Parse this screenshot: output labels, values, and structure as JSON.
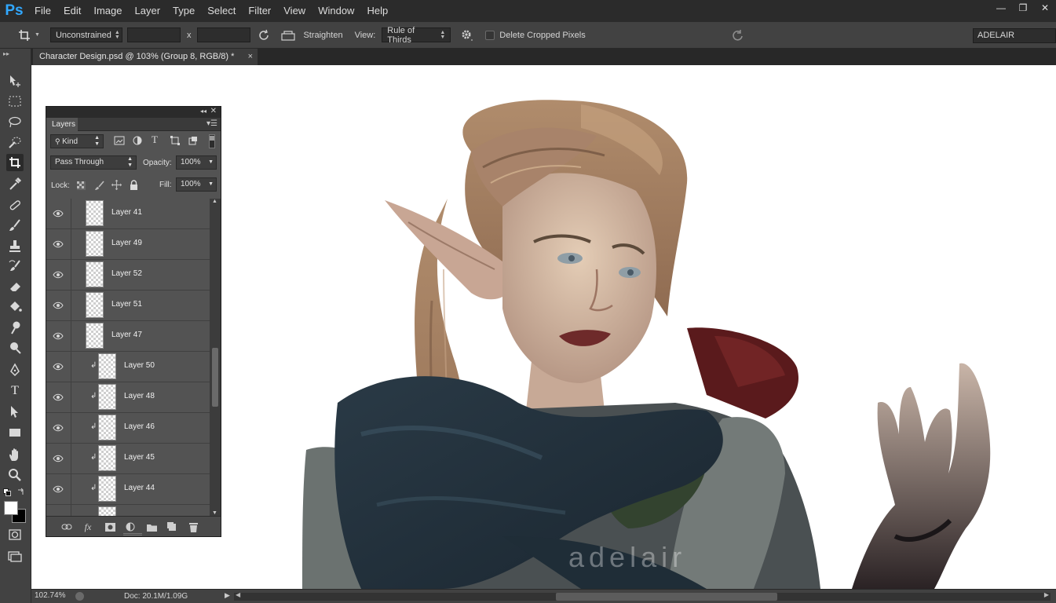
{
  "app": {
    "logo": "Ps"
  },
  "menu": [
    "File",
    "Edit",
    "Image",
    "Layer",
    "Type",
    "Select",
    "Filter",
    "View",
    "Window",
    "Help"
  ],
  "window_controls": {
    "minimize": "—",
    "restore": "❐",
    "close": "✕"
  },
  "options": {
    "ratio_value": "Unconstrained",
    "separator_x": "x",
    "straighten_label": "Straighten",
    "view_label": "View:",
    "view_value": "Rule of Thirds",
    "delete_cropped_label": "Delete Cropped Pixels",
    "workspace": "ADELAIR"
  },
  "document": {
    "tab_title": "Character Design.psd @ 103% (Group 8, RGB/8) *",
    "tab_close": "×",
    "watermark": "adelair"
  },
  "status": {
    "zoom": "102.74%",
    "doc_info": "Doc: 20.1M/1.09G"
  },
  "layers_panel": {
    "tab": "Layers",
    "filter_kind": "Kind",
    "blend_mode": "Pass Through",
    "opacity_label": "Opacity:",
    "opacity_value": "100%",
    "lock_label": "Lock:",
    "fill_label": "Fill:",
    "fill_value": "100%",
    "layers": [
      {
        "name": "Layer 41",
        "clipped": false
      },
      {
        "name": "Layer 49",
        "clipped": false
      },
      {
        "name": "Layer 52",
        "clipped": false
      },
      {
        "name": "Layer 51",
        "clipped": false
      },
      {
        "name": "Layer 47",
        "clipped": false
      },
      {
        "name": "Layer 50",
        "clipped": true
      },
      {
        "name": "Layer 48",
        "clipped": true
      },
      {
        "name": "Layer 46",
        "clipped": true
      },
      {
        "name": "Layer 45",
        "clipped": true
      },
      {
        "name": "Layer 44",
        "clipped": true
      }
    ],
    "footer_fx": "fx"
  },
  "colors": {
    "ui_dark": "#2b2b2b",
    "ui_mid": "#424242",
    "panel": "#535353",
    "canvas": "#ffffff",
    "ps_blue": "#31a8ff"
  }
}
